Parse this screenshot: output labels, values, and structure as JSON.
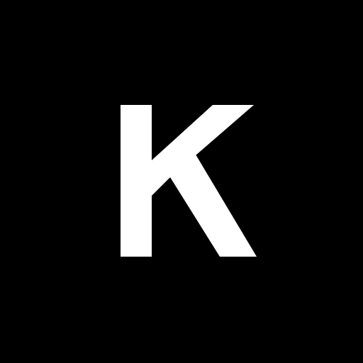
{
  "logo": {
    "letter": "K",
    "background_color": "#000000",
    "foreground_color": "#FFFFFF"
  }
}
